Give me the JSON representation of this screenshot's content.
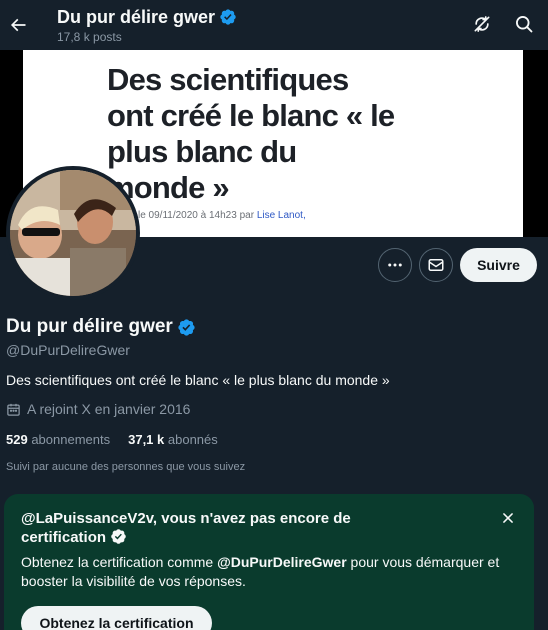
{
  "header": {
    "title": "Du pur délire gwer",
    "posts_count": "17,8 k posts"
  },
  "banner": {
    "headline": "Des scientifiques\nont créé le blanc « le\nplus blanc du\nmonde »",
    "meta_prefix": "le 09/11/2020 à 14h23 par ",
    "meta_author": "Lise Lanot,"
  },
  "actions": {
    "follow_label": "Suivre"
  },
  "profile": {
    "name": "Du pur délire gwer",
    "handle": "@DuPurDelireGwer",
    "bio": "Des scientifiques ont créé le blanc « le plus blanc du monde »",
    "joined": "A rejoint X en janvier 2016",
    "following_count": "529",
    "following_label": "abonnements",
    "followers_count": "37,1 k",
    "followers_label": "abonnés",
    "followed_by": "Suivi par aucune des personnes que vous suivez"
  },
  "certification": {
    "title": "@LaPuissanceV2v, vous n'avez pas encore de certification",
    "body_prefix": "Obtenez la certification comme ",
    "body_handle": "@DuPurDelireGwer",
    "body_suffix": " pour vous démarquer et booster la visibilité de vos réponses.",
    "cta_label": "Obtenez la certification"
  },
  "colors": {
    "background": "#15202b",
    "verified": "#1d9bf0",
    "cert_card": "#0a3b2d",
    "muted_text": "#8b98a5"
  },
  "icons": {
    "back": "arrow-left-icon",
    "notify": "bell-off-icon",
    "search": "search-icon",
    "more": "more-horizontal-icon",
    "message": "envelope-icon",
    "calendar": "calendar-icon",
    "close": "close-icon",
    "verified": "verified-badge-icon"
  }
}
